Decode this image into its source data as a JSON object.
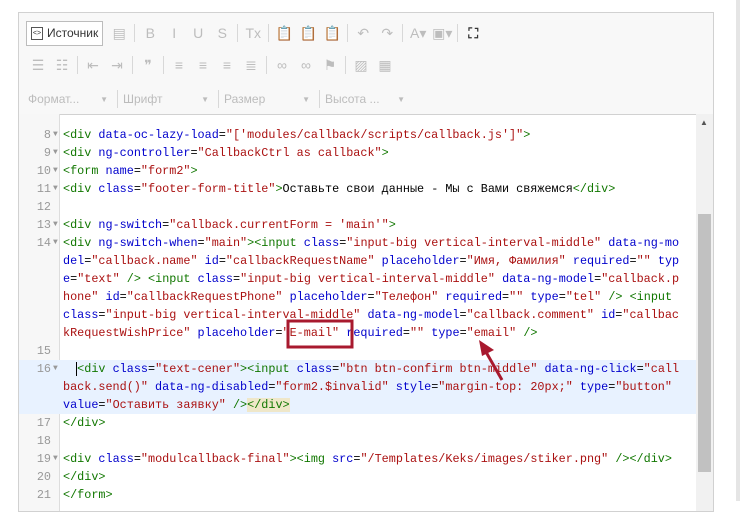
{
  "toolbar": {
    "source_button": "Источник",
    "row1": [
      {
        "name": "templates-icon",
        "glyph": "▤"
      },
      {
        "sep": true
      },
      {
        "name": "bold-icon",
        "glyph": "B"
      },
      {
        "name": "italic-icon",
        "glyph": "I"
      },
      {
        "name": "underline-icon",
        "glyph": "U"
      },
      {
        "name": "strike-icon",
        "glyph": "S"
      },
      {
        "sep": true
      },
      {
        "name": "remove-format-icon",
        "glyph": "Tx"
      },
      {
        "sep": true
      },
      {
        "name": "paste-icon",
        "glyph": "📋"
      },
      {
        "name": "paste-text-icon",
        "glyph": "📋"
      },
      {
        "name": "paste-word-icon",
        "glyph": "📋"
      },
      {
        "sep": true
      },
      {
        "name": "undo-icon",
        "glyph": "↶"
      },
      {
        "name": "redo-icon",
        "glyph": "↷"
      },
      {
        "sep": true
      },
      {
        "name": "text-color-icon",
        "glyph": "A▾"
      },
      {
        "name": "bg-color-icon",
        "glyph": "▣▾"
      },
      {
        "sep": true
      },
      {
        "name": "maximize-icon",
        "glyph": "⛶",
        "dark": true
      }
    ],
    "row2": [
      {
        "name": "numbered-list-icon",
        "glyph": "☰"
      },
      {
        "name": "bulleted-list-icon",
        "glyph": "☷"
      },
      {
        "sep": true
      },
      {
        "name": "outdent-icon",
        "glyph": "⇤"
      },
      {
        "name": "indent-icon",
        "glyph": "⇥"
      },
      {
        "sep": true
      },
      {
        "name": "blockquote-icon",
        "glyph": "❞"
      },
      {
        "sep": true
      },
      {
        "name": "align-left-icon",
        "glyph": "≡"
      },
      {
        "name": "align-center-icon",
        "glyph": "≡"
      },
      {
        "name": "align-right-icon",
        "glyph": "≡"
      },
      {
        "name": "align-justify-icon",
        "glyph": "≣"
      },
      {
        "sep": true
      },
      {
        "name": "link-icon",
        "glyph": "∞"
      },
      {
        "name": "unlink-icon",
        "glyph": "∞"
      },
      {
        "name": "anchor-flag-icon",
        "glyph": "⚑"
      },
      {
        "sep": true
      },
      {
        "name": "image-icon",
        "glyph": "▨"
      },
      {
        "name": "table-icon",
        "glyph": "▦"
      }
    ],
    "combos": [
      "Формат...",
      "Шрифт",
      "Размер",
      "Высота ..."
    ]
  },
  "code": {
    "lines": [
      {
        "n": "8",
        "fold": true,
        "t": [
          [
            "tag",
            "<div"
          ],
          [
            "txt",
            " "
          ],
          [
            "attr",
            "data-oc-lazy-load"
          ],
          [
            "txt",
            "="
          ],
          [
            "str",
            "\"['modules/callback/scripts/callback.js']\""
          ],
          [
            "tag",
            ">"
          ]
        ]
      },
      {
        "n": "9",
        "fold": true,
        "t": [
          [
            "tag",
            "<div"
          ],
          [
            "txt",
            " "
          ],
          [
            "attr",
            "ng-controller"
          ],
          [
            "txt",
            "="
          ],
          [
            "str",
            "\"CallbackCtrl as callback\""
          ],
          [
            "tag",
            ">"
          ]
        ]
      },
      {
        "n": "10",
        "fold": true,
        "t": [
          [
            "tag",
            "<form"
          ],
          [
            "txt",
            " "
          ],
          [
            "attr",
            "name"
          ],
          [
            "txt",
            "="
          ],
          [
            "str",
            "\"form2\""
          ],
          [
            "tag",
            ">"
          ]
        ]
      },
      {
        "n": "11",
        "fold": true,
        "t": [
          [
            "tag",
            "<div"
          ],
          [
            "txt",
            " "
          ],
          [
            "attr",
            "class"
          ],
          [
            "txt",
            "="
          ],
          [
            "str",
            "\"footer-form-title\""
          ],
          [
            "tag",
            ">"
          ],
          [
            "txt",
            "Оставьте свои данные - Мы с Вами свяжемся"
          ],
          [
            "tag",
            "</div>"
          ]
        ]
      },
      {
        "n": "12",
        "fold": false,
        "t": []
      },
      {
        "n": "13",
        "fold": true,
        "t": [
          [
            "tag",
            "<div"
          ],
          [
            "txt",
            " "
          ],
          [
            "attr",
            "ng-switch"
          ],
          [
            "txt",
            "="
          ],
          [
            "str",
            "\"callback.currentForm = 'main'\""
          ],
          [
            "tag",
            ">"
          ]
        ]
      },
      {
        "n": "14",
        "fold": true,
        "t": [
          [
            "tag",
            "<div"
          ],
          [
            "txt",
            " "
          ],
          [
            "attr",
            "ng-switch-when"
          ],
          [
            "txt",
            "="
          ],
          [
            "str",
            "\"main\""
          ],
          [
            "tag",
            "><input"
          ],
          [
            "txt",
            " "
          ],
          [
            "attr",
            "class"
          ],
          [
            "txt",
            "="
          ],
          [
            "str",
            "\"input-big vertical-interval-middle\""
          ],
          [
            "txt",
            " "
          ],
          [
            "attr",
            "data-ng-model"
          ],
          [
            "txt",
            "="
          ],
          [
            "str",
            "\"callback.name\""
          ],
          [
            "txt",
            " "
          ],
          [
            "attr",
            "id"
          ],
          [
            "txt",
            "="
          ],
          [
            "str",
            "\"callbackRequestName\""
          ],
          [
            "txt",
            " "
          ],
          [
            "attr",
            "placeholder"
          ],
          [
            "txt",
            "="
          ],
          [
            "str",
            "\"Имя, Фамилия\""
          ],
          [
            "txt",
            " "
          ],
          [
            "attr",
            "required"
          ],
          [
            "txt",
            "="
          ],
          [
            "str",
            "\"\""
          ],
          [
            "txt",
            " "
          ],
          [
            "attr",
            "type"
          ],
          [
            "txt",
            "="
          ],
          [
            "str",
            "\"text\""
          ],
          [
            "txt",
            " "
          ],
          [
            "tag",
            "/>"
          ],
          [
            "txt",
            " "
          ],
          [
            "tag",
            "<input"
          ],
          [
            "txt",
            " "
          ],
          [
            "attr",
            "class"
          ],
          [
            "txt",
            "="
          ],
          [
            "str",
            "\"input-big vertical-interval-middle\""
          ],
          [
            "txt",
            " "
          ],
          [
            "attr",
            "data-ng-model"
          ],
          [
            "txt",
            "="
          ],
          [
            "str",
            "\"callback.phone\""
          ],
          [
            "txt",
            " "
          ],
          [
            "attr",
            "id"
          ],
          [
            "txt",
            "="
          ],
          [
            "str",
            "\"callbackRequestPhone\""
          ],
          [
            "txt",
            " "
          ],
          [
            "attr",
            "placeholder"
          ],
          [
            "txt",
            "="
          ],
          [
            "str",
            "\"Телефон\""
          ],
          [
            "txt",
            " "
          ],
          [
            "attr",
            "required"
          ],
          [
            "txt",
            "="
          ],
          [
            "str",
            "\"\""
          ],
          [
            "txt",
            " "
          ],
          [
            "attr",
            "type"
          ],
          [
            "txt",
            "="
          ],
          [
            "str",
            "\"tel\""
          ],
          [
            "txt",
            " "
          ],
          [
            "tag",
            "/>"
          ],
          [
            "txt",
            " "
          ],
          [
            "tag",
            "<input"
          ],
          [
            "txt",
            " "
          ],
          [
            "attr",
            "class"
          ],
          [
            "txt",
            "="
          ],
          [
            "str",
            "\"input-big vertical-interval-middle\""
          ],
          [
            "txt",
            " "
          ],
          [
            "attr",
            "data-ng-model"
          ],
          [
            "txt",
            "="
          ],
          [
            "str",
            "\"callback.comment\""
          ],
          [
            "txt",
            " "
          ],
          [
            "attr",
            "id"
          ],
          [
            "txt",
            "="
          ],
          [
            "str",
            "\"callbackRequestWishPrice\""
          ],
          [
            "txt",
            " "
          ],
          [
            "attr",
            "placeholder"
          ],
          [
            "txt",
            "="
          ],
          [
            "str",
            "\"E-mail\""
          ],
          [
            "txt",
            " "
          ],
          [
            "attr",
            "required"
          ],
          [
            "txt",
            "="
          ],
          [
            "str",
            "\"\""
          ],
          [
            "txt",
            " "
          ],
          [
            "attr",
            "type"
          ],
          [
            "txt",
            "="
          ],
          [
            "str",
            "\"email\""
          ],
          [
            "txt",
            " "
          ],
          [
            "tag",
            "/>"
          ]
        ]
      },
      {
        "n": "15",
        "fold": false,
        "t": []
      },
      {
        "n": "16",
        "fold": true,
        "active": true,
        "t": [
          [
            "txt",
            "  "
          ],
          [
            "cursor",
            ""
          ],
          [
            "tag",
            "<div"
          ],
          [
            "txt",
            " "
          ],
          [
            "attr",
            "class"
          ],
          [
            "txt",
            "="
          ],
          [
            "str",
            "\"text-cener\""
          ],
          [
            "tag",
            "><input"
          ],
          [
            "txt",
            " "
          ],
          [
            "attr",
            "class"
          ],
          [
            "txt",
            "="
          ],
          [
            "str",
            "\"btn btn-confirm btn-middle\""
          ],
          [
            "txt",
            " "
          ],
          [
            "attr",
            "data-ng-click"
          ],
          [
            "txt",
            "="
          ],
          [
            "str",
            "\"callback.send()\""
          ],
          [
            "txt",
            " "
          ],
          [
            "attr",
            "data-ng-disabled"
          ],
          [
            "txt",
            "="
          ],
          [
            "str",
            "\"form2.$invalid\""
          ],
          [
            "txt",
            " "
          ],
          [
            "attr",
            "style"
          ],
          [
            "txt",
            "="
          ],
          [
            "str",
            "\"margin-top: 20px;\""
          ],
          [
            "txt",
            " "
          ],
          [
            "attr",
            "type"
          ],
          [
            "txt",
            "="
          ],
          [
            "str",
            "\"button\""
          ],
          [
            "txt",
            " "
          ],
          [
            "attr",
            "value"
          ],
          [
            "txt",
            "="
          ],
          [
            "str",
            "\"Оставить заявку\""
          ],
          [
            "txt",
            " "
          ],
          [
            "tag",
            "/>"
          ],
          [
            "tagm",
            "</div>"
          ]
        ]
      },
      {
        "n": "17",
        "fold": false,
        "t": [
          [
            "tag",
            "</div>"
          ]
        ]
      },
      {
        "n": "18",
        "fold": false,
        "t": []
      },
      {
        "n": "19",
        "fold": true,
        "t": [
          [
            "tag",
            "<div"
          ],
          [
            "txt",
            " "
          ],
          [
            "attr",
            "class"
          ],
          [
            "txt",
            "="
          ],
          [
            "str",
            "\"modulcallback-final\""
          ],
          [
            "tag",
            "><img"
          ],
          [
            "txt",
            " "
          ],
          [
            "attr",
            "src"
          ],
          [
            "txt",
            "="
          ],
          [
            "str",
            "\"/Templates/Keks/images/stiker.png\""
          ],
          [
            "txt",
            " "
          ],
          [
            "tag",
            "/></div>"
          ]
        ]
      },
      {
        "n": "20",
        "fold": false,
        "t": [
          [
            "tag",
            "</div>"
          ]
        ]
      },
      {
        "n": "21",
        "fold": false,
        "t": [
          [
            "tag",
            "</form>"
          ]
        ]
      }
    ]
  },
  "annotation": {
    "highlight_color": "#a8192e"
  },
  "colors": {
    "tag": "#117700",
    "attribute": "#0000cc",
    "string": "#aa1111"
  }
}
